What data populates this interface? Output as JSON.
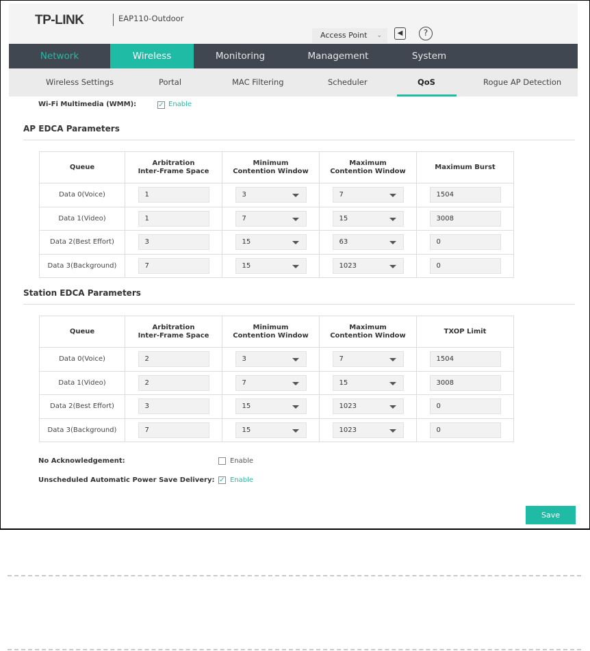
{
  "header": {
    "brand": "TP-LINK",
    "model": "EAP110-Outdoor",
    "mode": "Access Point"
  },
  "nav": [
    {
      "label": "Network"
    },
    {
      "label": "Wireless"
    },
    {
      "label": "Monitoring"
    },
    {
      "label": "Management"
    },
    {
      "label": "System"
    }
  ],
  "subnav": [
    {
      "label": "Wireless Settings"
    },
    {
      "label": "Portal"
    },
    {
      "label": "MAC Filtering"
    },
    {
      "label": "Scheduler"
    },
    {
      "label": "QoS"
    },
    {
      "label": "Rogue AP Detection"
    }
  ],
  "wmm": {
    "label": "Wi-Fi Multimedia (WMM):",
    "option": "Enable",
    "checked": true
  },
  "ap": {
    "title": "AP EDCA Parameters",
    "headers": [
      "Queue",
      "Arbitration\nInter-Frame Space",
      "Minimum\nContention Window",
      "Maximum\nContention Window",
      "Maximum Burst"
    ],
    "rows": [
      [
        "Data 0(Voice)",
        "1",
        "3",
        "7",
        "1504"
      ],
      [
        "Data 1(Video)",
        "1",
        "7",
        "15",
        "3008"
      ],
      [
        "Data 2(Best Effort)",
        "3",
        "15",
        "63",
        "0"
      ],
      [
        "Data 3(Background)",
        "7",
        "15",
        "1023",
        "0"
      ]
    ]
  },
  "station": {
    "title": "Station EDCA Parameters",
    "headers": [
      "Queue",
      "Arbitration\nInter-Frame Space",
      "Minimum\nContention Window",
      "Maximum\nContention Window",
      "TXOP Limit"
    ],
    "rows": [
      [
        "Data 0(Voice)",
        "2",
        "3",
        "7",
        "1504"
      ],
      [
        "Data 1(Video)",
        "2",
        "7",
        "15",
        "3008"
      ],
      [
        "Data 2(Best Effort)",
        "3",
        "15",
        "1023",
        "0"
      ],
      [
        "Data 3(Background)",
        "7",
        "15",
        "1023",
        "0"
      ]
    ]
  },
  "no_ack": {
    "label": "No Acknowledgement:",
    "option": "Enable",
    "checked": false
  },
  "uapsd": {
    "label": "Unscheduled Automatic Power Save Delivery:",
    "option": "Enable",
    "checked": true
  },
  "save_label": "Save",
  "colors": {
    "accent": "#20bba5",
    "nav_bg": "#414750"
  }
}
